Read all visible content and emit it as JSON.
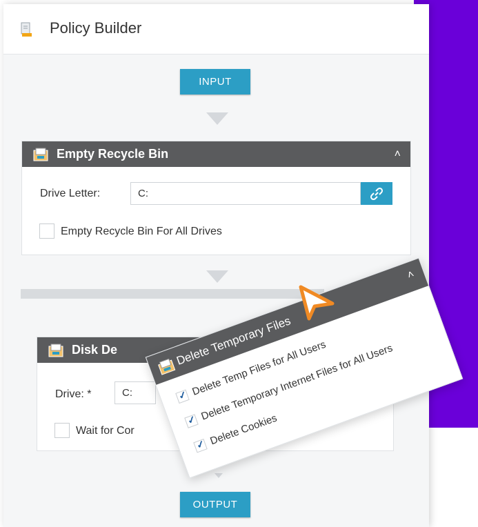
{
  "header": {
    "title": "Policy Builder",
    "icon": "document-icon"
  },
  "flow": {
    "input_label": "INPUT",
    "output_label": "OUTPUT"
  },
  "recycle_card": {
    "title": "Empty Recycle Bin",
    "drive_label": "Drive Letter:",
    "drive_value": "C:",
    "all_drives_label": "Empty Recycle Bin For All Drives"
  },
  "disk_card": {
    "title": "Disk De",
    "drive_label": "Drive: *",
    "drive_value": "C:",
    "wait_label": "Wait for Cor"
  },
  "temp_card": {
    "title": "Delete Temporary Files",
    "options": [
      "Delete Temp Files for All Users",
      "Delete Temporary Internet Files for All Users",
      "Delete Cookies"
    ]
  },
  "colors": {
    "accent": "#2c9ec5",
    "card_header": "#5a5b5d",
    "backdrop": "#6a00d9",
    "cursor": "#f08a24"
  }
}
